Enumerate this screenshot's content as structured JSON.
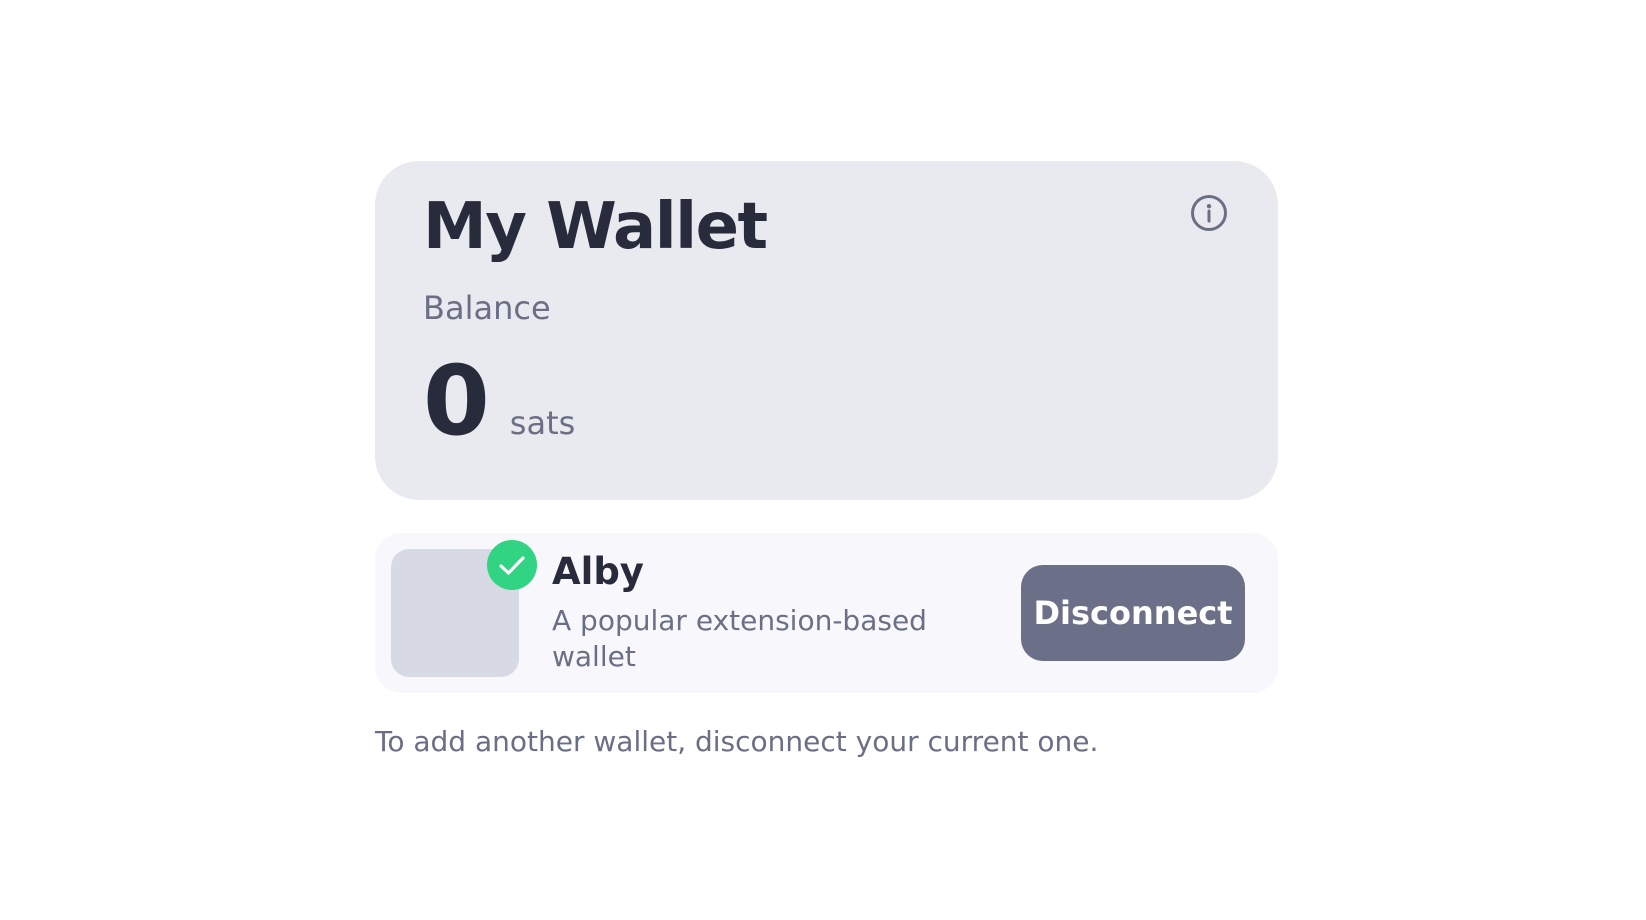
{
  "wallet_card": {
    "title": "My Wallet",
    "info_icon": "info-icon",
    "balance_label": "Balance",
    "balance_amount": "0",
    "balance_unit": "sats"
  },
  "connected_wallet": {
    "name": "Alby",
    "description": "A popular extension-based wallet",
    "status_icon": "check-icon",
    "status_color": "#31d482",
    "disconnect_label": "Disconnect"
  },
  "help_text": "To add another wallet, disconnect your current one.",
  "colors": {
    "card_background": "#e9eaf0",
    "row_background": "#f8f8fc",
    "logo_placeholder": "#d7d9e4",
    "button_background": "#6b6f87",
    "text_primary": "#272b3b",
    "text_secondary": "#6b6f85"
  }
}
